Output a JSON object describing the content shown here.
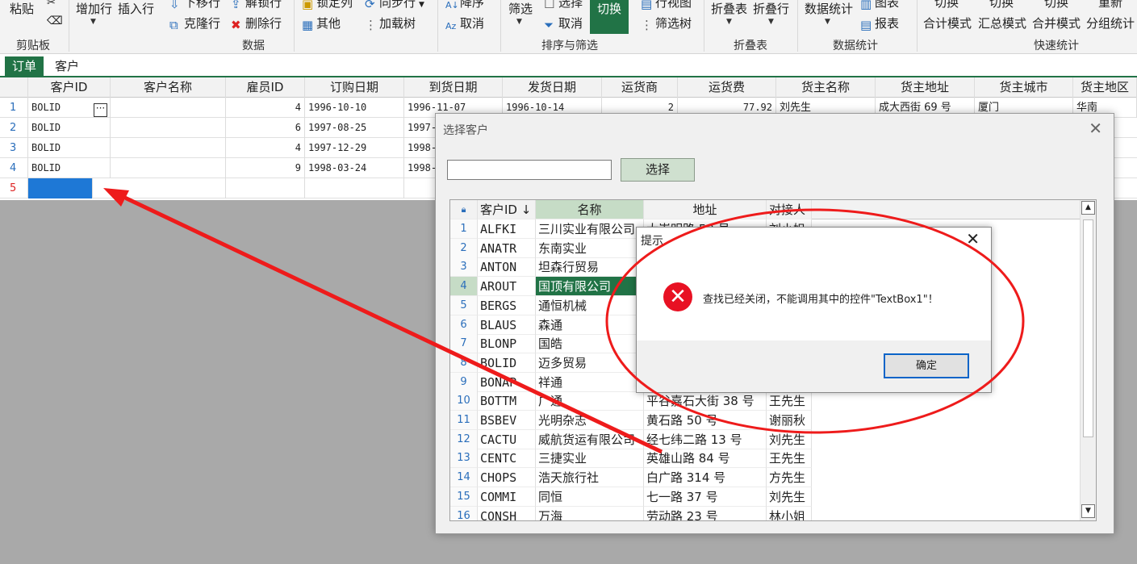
{
  "ribbon": {
    "paste": "粘贴",
    "clipboard_group": "剪贴板",
    "add_row": "增加行",
    "insert_row": "插入行",
    "move_down": "下移行",
    "unlock_row": "解锁行",
    "clone_row": "克隆行",
    "delete_row": "删除行",
    "data_group": "数据",
    "lock_col": "锁定列",
    "sync_row": "同步行",
    "other": "其他",
    "load_tree": "加载树",
    "descending": "降序",
    "cancel_sort": "取消",
    "filter": "筛选",
    "select": "选择",
    "cancel_filter": "取消",
    "switch": "切换",
    "row_view": "行视图",
    "filter_tree": "筛选树",
    "sort_filter_group": "排序与筛选",
    "fold_table": "折叠表",
    "fold_row": "折叠行",
    "fold_group": "折叠表",
    "data_stats": "数据统计",
    "chart": "图表",
    "report": "报表",
    "data_stats_group": "数据统计",
    "qs_switch1": "切换",
    "qs_mode1": "合计模式",
    "qs_switch2": "切换",
    "qs_mode2": "汇总模式",
    "qs_switch3": "切换",
    "qs_mode3": "合并模式",
    "qs_renew": "重新",
    "qs_group": "分组统计",
    "quick_stats_group": "快速统计"
  },
  "tabs": [
    "订单",
    "客户"
  ],
  "grid": {
    "columns": [
      "客户ID",
      "客户名称",
      "雇员ID",
      "订购日期",
      "到货日期",
      "发货日期",
      "运货商",
      "运货费",
      "货主名称",
      "货主地址",
      "货主城市",
      "货主地区"
    ],
    "rows": [
      {
        "n": "1",
        "cid": "BOLID",
        "name": "",
        "emp": "4",
        "order": "1996-10-10",
        "arrive": "1996-11-07",
        "ship": "1996-10-14",
        "carrier": "2",
        "freight": "77.92",
        "owner": "刘先生",
        "addr": "成大西街 69 号",
        "city": "厦门",
        "region": "华南"
      },
      {
        "n": "2",
        "cid": "BOLID",
        "name": "",
        "emp": "6",
        "order": "1997-08-25",
        "arrive": "1997-"
      },
      {
        "n": "3",
        "cid": "BOLID",
        "name": "",
        "emp": "4",
        "order": "1997-12-29",
        "arrive": "1998-"
      },
      {
        "n": "4",
        "cid": "BOLID",
        "name": "",
        "emp": "9",
        "order": "1998-03-24",
        "arrive": "1998-"
      },
      {
        "n": "5"
      }
    ],
    "ellipsis": "···"
  },
  "dialog": {
    "title": "选择客户",
    "close": "✕",
    "search_value": "",
    "select_button": "选择",
    "columns": [
      "客户ID ↓",
      "名称",
      "地址",
      "对接人"
    ],
    "rows": [
      {
        "n": "1",
        "id": "ALFKI",
        "name": "三川实业有限公司",
        "addr": "大崇明路 50 号",
        "contact": "刘小姐"
      },
      {
        "n": "2",
        "id": "ANATR",
        "name": "东南实业",
        "addr": "",
        "contact": ""
      },
      {
        "n": "3",
        "id": "ANTON",
        "name": "坦森行贸易",
        "addr": "",
        "contact": ""
      },
      {
        "n": "4",
        "id": "AROUT",
        "name": "国顶有限公司",
        "addr": "",
        "contact": ""
      },
      {
        "n": "5",
        "id": "BERGS",
        "name": "通恒机械",
        "addr": "",
        "contact": ""
      },
      {
        "n": "6",
        "id": "BLAUS",
        "name": "森通",
        "addr": "",
        "contact": ""
      },
      {
        "n": "7",
        "id": "BLONP",
        "name": "国皓",
        "addr": "",
        "contact": ""
      },
      {
        "n": "8",
        "id": "BOLID",
        "name": "迈多贸易",
        "addr": "",
        "contact": ""
      },
      {
        "n": "9",
        "id": "BONAP",
        "name": "祥通",
        "addr": "",
        "contact": ""
      },
      {
        "n": "10",
        "id": "BOTTM",
        "name": "广通",
        "addr": "平谷嘉石大街 38 号",
        "contact": "王先生"
      },
      {
        "n": "11",
        "id": "BSBEV",
        "name": "光明杂志",
        "addr": "黄石路 50 号",
        "contact": "谢丽秋"
      },
      {
        "n": "12",
        "id": "CACTU",
        "name": "威航货运有限公司",
        "addr": "经七纬二路 13 号",
        "contact": "刘先生"
      },
      {
        "n": "13",
        "id": "CENTC",
        "name": "三捷实业",
        "addr": "英雄山路 84 号",
        "contact": "王先生"
      },
      {
        "n": "14",
        "id": "CHOPS",
        "name": "浩天旅行社",
        "addr": "白广路 314 号",
        "contact": "方先生"
      },
      {
        "n": "15",
        "id": "COMMI",
        "name": "同恒",
        "addr": "七一路 37 号",
        "contact": "刘先生"
      },
      {
        "n": "16",
        "id": "CONSH",
        "name": "万海",
        "addr": "劳动路 23 号",
        "contact": "林小姐"
      }
    ],
    "selected_row": "4"
  },
  "message": {
    "title": "提示",
    "close": "✕",
    "icon": "✕",
    "text": "查找已经关闭，不能调用其中的控件\"TextBox1\"！",
    "ok": "确定"
  },
  "annotation": {
    "arrow_color": "#ee1b1b",
    "circle_color": "#ee1b1b"
  }
}
